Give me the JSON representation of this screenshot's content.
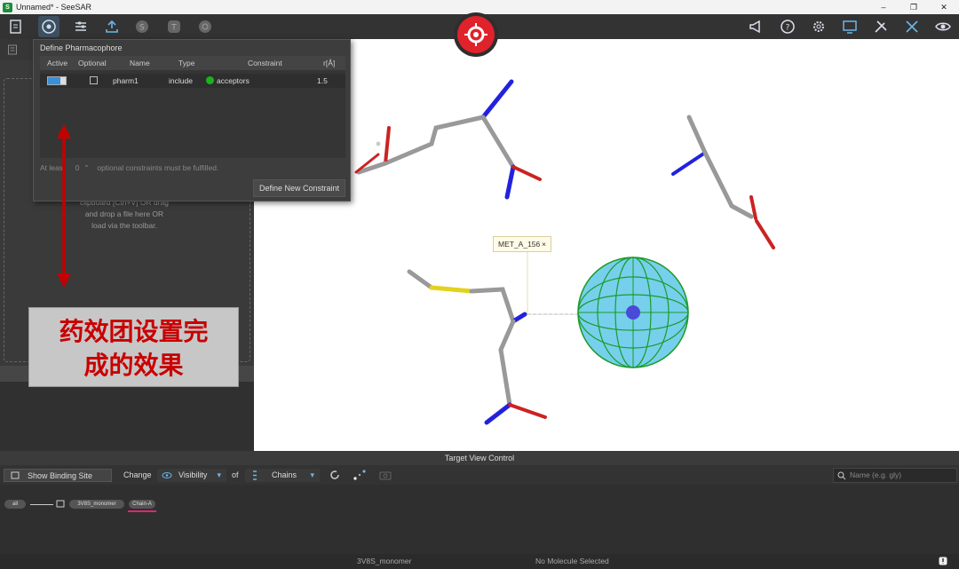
{
  "window": {
    "title": "Unnamed* - SeeSAR",
    "minimize": "–",
    "restore": "❐",
    "close": "✕"
  },
  "toolbar": {
    "left_icons": [
      "file-icon",
      "pharmacophore-icon",
      "sliders-icon",
      "export-icon",
      "s-icon",
      "t-icon",
      "settings-outline-icon"
    ],
    "right_icons": [
      "megaphone-icon",
      "help-icon",
      "gear-icon",
      "monitor-icon",
      "tools-icon",
      "tools-alt-icon",
      "eye-icon"
    ]
  },
  "left_panel": {
    "drop_text": "clipboard [Ctrl+V] OR drag and drop a file here OR load via the toolbar."
  },
  "pharmacophore_dialog": {
    "title": "Define Pharmacophore",
    "columns": [
      "Active",
      "Optional",
      "Name",
      "Type",
      "Constraint",
      "r[Å]"
    ],
    "rows": [
      {
        "name": "pharm1",
        "type": "include",
        "constraint": "acceptors",
        "radius": "1.5"
      }
    ],
    "at_least_label": "At least",
    "at_least_value": "0",
    "optional_text": "optional constraints must be fulfilled.",
    "new_constraint_button": "Define New Constraint"
  },
  "caption": {
    "line1": "药效团设置完",
    "line2": "成的效果"
  },
  "viewport": {
    "residue_label": "MET_A_156",
    "label_close": "×"
  },
  "target_view_control": {
    "title": "Target View Control",
    "binding_site_button": "Show Binding Site Only",
    "change_label": "Change",
    "visibility_label": "Visibility",
    "of_label": "of",
    "chains_label": "Chains",
    "search_placeholder": "Name (e.g. gly)"
  },
  "tree": {
    "root": "all",
    "node": "3V8S_monomer",
    "chain": "Chain-A"
  },
  "status": {
    "molecule": "3V8S_monomer",
    "selection": "No Molecule Selected"
  },
  "colors": {
    "accent": "#e0222a",
    "sphere": "#5ec8e8",
    "sphere_grid": "#1a9b2a",
    "highlight": "#e0247a"
  }
}
